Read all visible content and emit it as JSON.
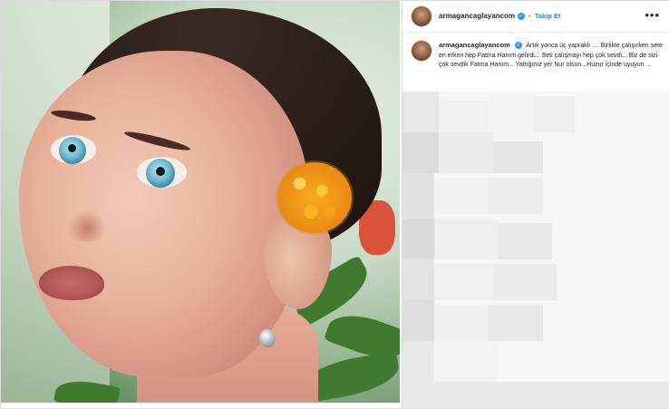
{
  "post": {
    "username": "armagancaglayancom",
    "follow_label": "Takip Et",
    "more_label": "•••",
    "separator": "•",
    "caption": "Artık yonca üç yapraklı .... Birlikte çalışırken sete en erken hep Fatma Hanım gelirdi... Seti çalışmayı hep çok sevdi... Biz de sizi çok sevdik Fatma Hanım... Yattığınız yer Nur olsun...Huzur içinde uyuyun ...",
    "verified_icon": "verified-badge-icon"
  },
  "colors": {
    "accent": "#0095f6",
    "verified": "#3897f0",
    "text": "#262626",
    "border": "#dbdbdb"
  }
}
